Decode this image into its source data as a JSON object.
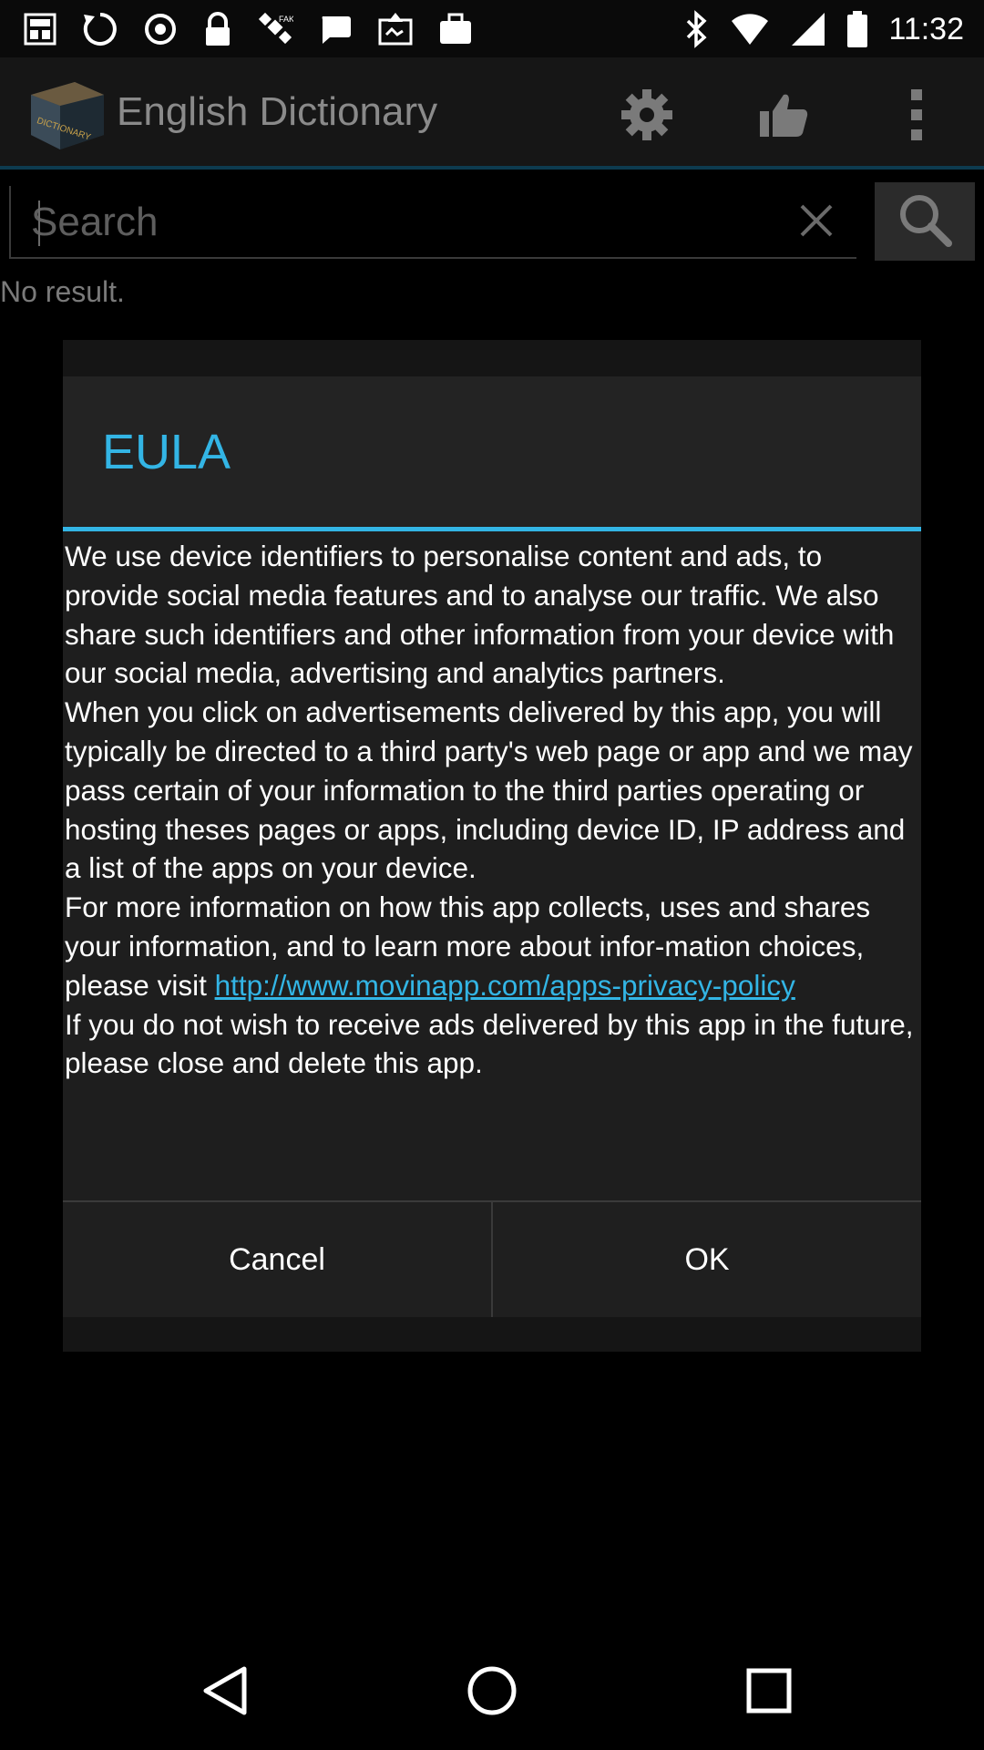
{
  "status_bar": {
    "time": "11:32",
    "icons": [
      "notification-icon",
      "sync-icon",
      "location-icon",
      "gps-satellite-icon",
      "chat-icon",
      "image-upload-icon",
      "briefcase-icon",
      "bluetooth-icon",
      "wifi-icon",
      "signal-icon",
      "battery-icon"
    ]
  },
  "app_bar": {
    "title": "English Dictionary",
    "logo_label": "DICTIONARY",
    "icons": [
      "settings-gear-icon",
      "thumbs-up-icon",
      "overflow-menu-icon"
    ]
  },
  "search": {
    "placeholder": "Search",
    "value": ""
  },
  "results": {
    "empty_text": "No result."
  },
  "dialog": {
    "title": "EULA",
    "paragraph_1": "We use device identifiers to personalise content and ads, to provide social media features and to analyse our traffic. We also share such identifiers and other information from your device with our social media, advertising and analytics partners.",
    "paragraph_2": "When you click on advertisements delivered by this app, you will typically be directed to a third party's web page or app and we may pass certain of your information to the third parties operating or hosting theses pages or apps, including device ID, IP address and a list of the apps on your device.",
    "paragraph_3_prefix": "For more information on how this app collects, uses and shares your information, and to learn more about infor-mation choices, please visit ",
    "link_text": "http://www.movinapp.com/apps-privacy-policy",
    "paragraph_4": "If you do not wish to receive ads delivered by this app in the future, please close and delete this app.",
    "cancel_label": "Cancel",
    "ok_label": "OK"
  },
  "colors": {
    "accent": "#33b5e5",
    "background": "#000000",
    "dialog_background": "#1e1e1e"
  },
  "nav_bar": {
    "icons": [
      "back-icon",
      "home-icon",
      "recents-icon"
    ]
  }
}
